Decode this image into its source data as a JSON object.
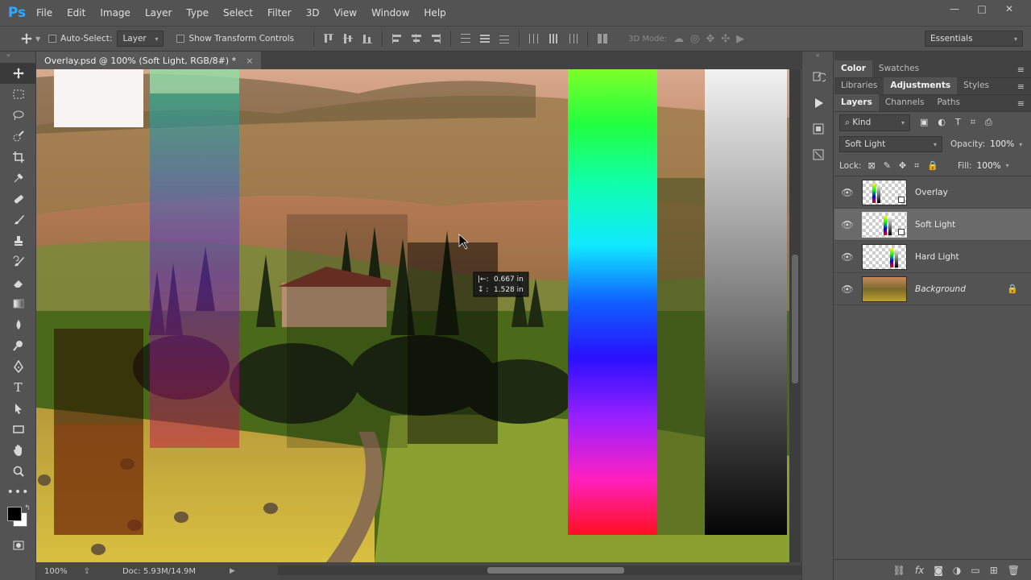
{
  "app": {
    "logo": "Ps"
  },
  "menu": [
    "File",
    "Edit",
    "Image",
    "Layer",
    "Type",
    "Select",
    "Filter",
    "3D",
    "View",
    "Window",
    "Help"
  ],
  "window_controls": [
    "—",
    "□",
    "✕"
  ],
  "options": {
    "auto_select_label": "Auto-Select:",
    "auto_select_value": "Layer",
    "show_transform_label": "Show Transform Controls",
    "mode_3d_label": "3D Mode:",
    "workspace": "Essentials"
  },
  "document": {
    "tab_title": "Overlay.psd @ 100% (Soft Light, RGB/8#) *",
    "close": "×",
    "measure_x": "0.667 in",
    "measure_y": "1.528 in"
  },
  "status": {
    "zoom": "100%",
    "doc": "Doc: 5.93M/14.9M"
  },
  "panels": {
    "top_tabs": [
      "Color",
      "Swatches"
    ],
    "mid_tabs": [
      "Libraries",
      "Adjustments",
      "Styles"
    ],
    "layer_tabs": [
      "Layers",
      "Channels",
      "Paths"
    ],
    "filter_kind": "Kind",
    "blend_mode": "Soft Light",
    "opacity_label": "Opacity:",
    "opacity_value": "100%",
    "lock_label": "Lock:",
    "fill_label": "Fill:",
    "fill_value": "100%",
    "layers": [
      {
        "name": "Overlay"
      },
      {
        "name": "Soft Light"
      },
      {
        "name": "Hard Light"
      },
      {
        "name": "Background"
      }
    ],
    "selected_layer": "Soft Light"
  }
}
